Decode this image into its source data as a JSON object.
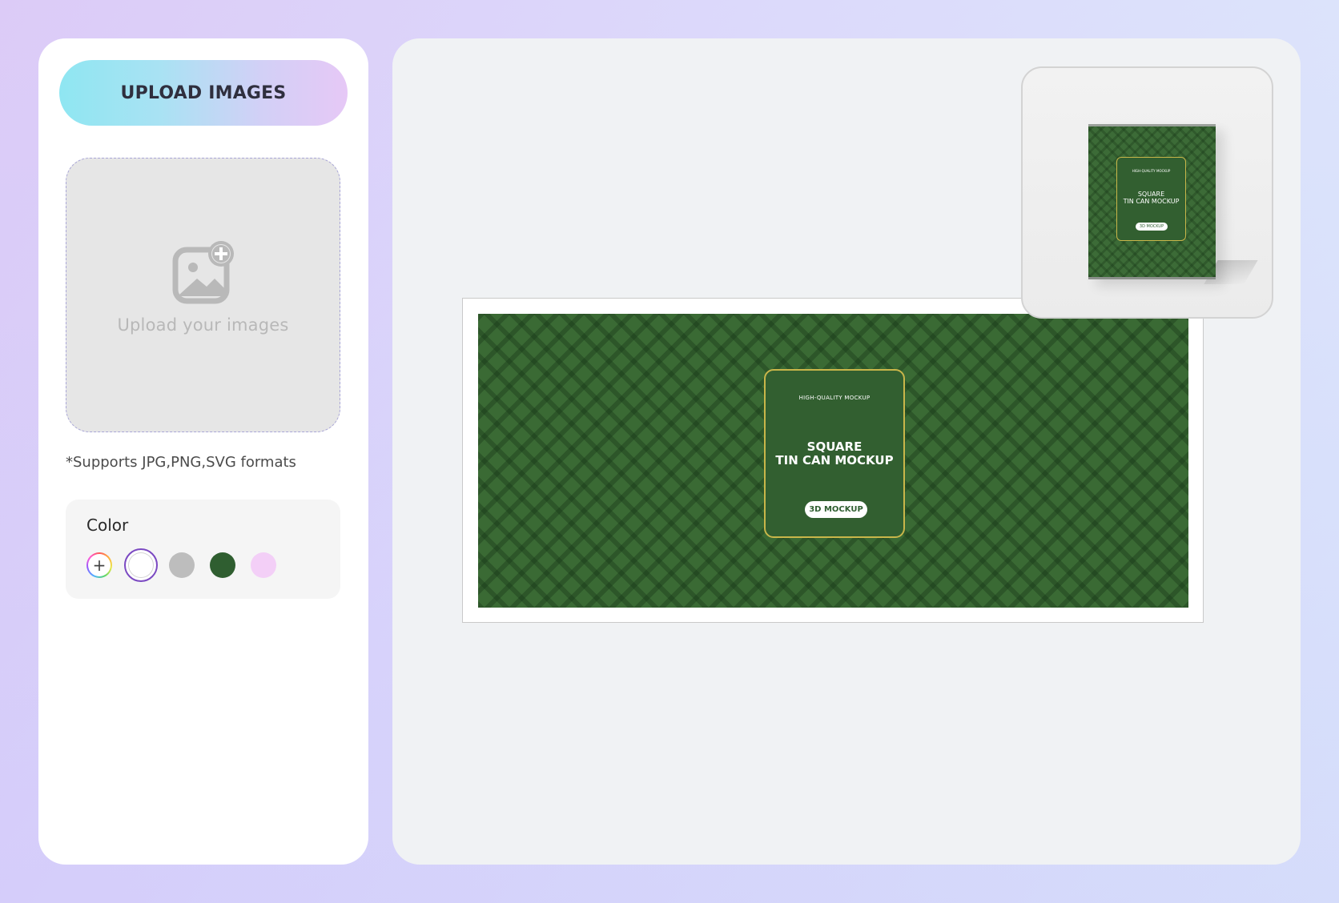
{
  "sidebar": {
    "upload_button_label": "UPLOAD IMAGES",
    "dropzone_label": "Upload your images",
    "formats_note": "*Supports JPG,PNG,SVG formats",
    "color_section": {
      "title": "Color",
      "add_symbol": "+",
      "swatches": [
        {
          "name": "custom",
          "color": "rainbow"
        },
        {
          "name": "white",
          "color": "#ffffff",
          "selected": true
        },
        {
          "name": "gray",
          "color": "#bdbdbd"
        },
        {
          "name": "green",
          "color": "#2f5e30"
        },
        {
          "name": "pink",
          "color": "#f3cff7"
        }
      ]
    }
  },
  "canvas": {
    "label": {
      "tagline": "HIGH-QUALITY MOCKUP",
      "title_line1": "SQUARE",
      "title_line2": "TIN CAN MOCKUP",
      "badge": "3D MOCKUP",
      "background_color": "#3a6a34",
      "border_color": "#c9b64a"
    }
  },
  "preview": {
    "tagline": "HIGH-QUALITY MOCKUP",
    "title_line1": "SQUARE",
    "title_line2": "TIN CAN MOCKUP",
    "badge": "3D MOCKUP"
  }
}
